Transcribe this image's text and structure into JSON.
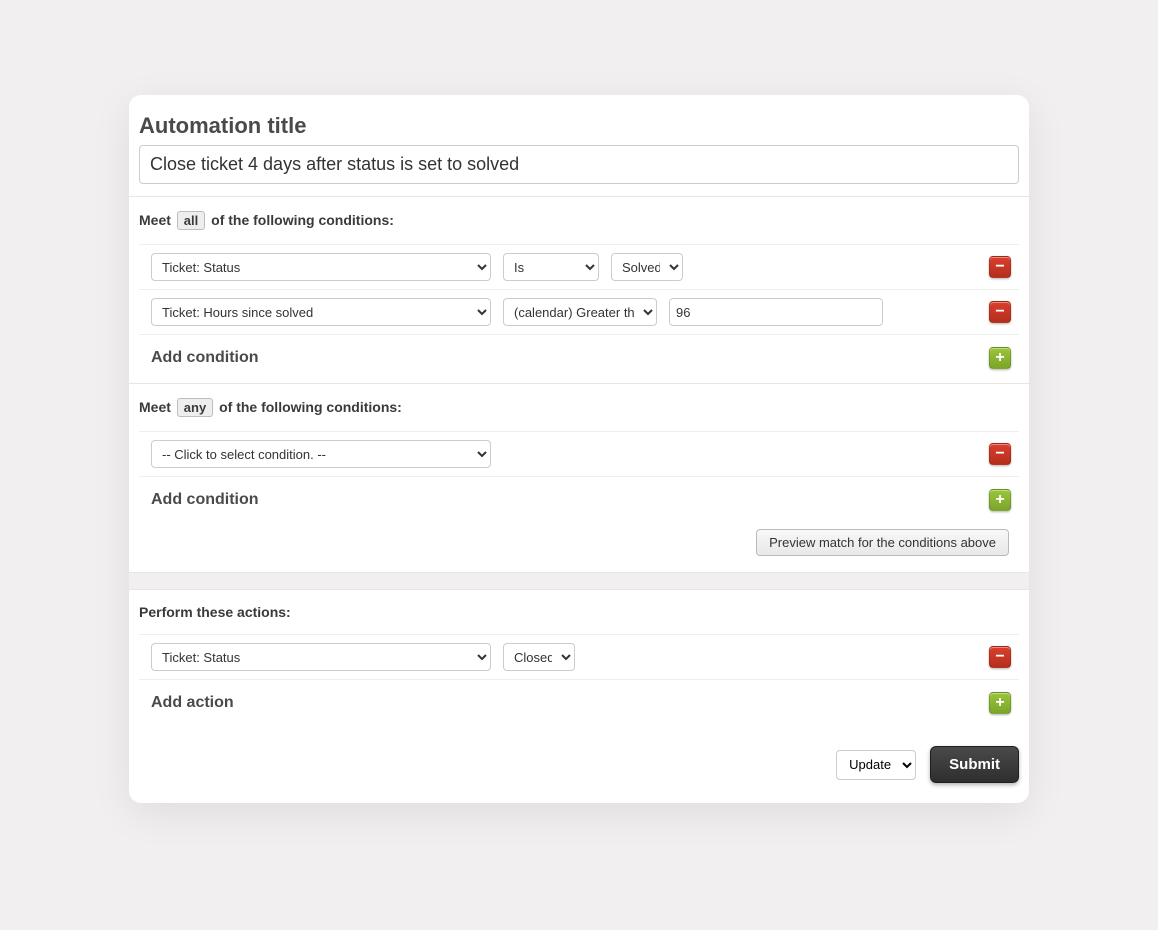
{
  "title_label": "Automation title",
  "title_value": "Close ticket 4 days after status is set to solved",
  "meet_all": {
    "prefix": "Meet",
    "word": "all",
    "suffix": "of the following conditions:"
  },
  "meet_any": {
    "prefix": "Meet",
    "word": "any",
    "suffix": "of the following conditions:"
  },
  "all_conditions": [
    {
      "field": "Ticket: Status",
      "operator": "Is",
      "value": "Solved",
      "value_type": "select"
    },
    {
      "field": "Ticket: Hours since solved",
      "operator": "(calendar) Greater than",
      "value": "96",
      "value_type": "text"
    }
  ],
  "any_conditions": [
    {
      "field": "-- Click to select condition. --"
    }
  ],
  "actions_label": "Perform these actions:",
  "actions": [
    {
      "field": "Ticket: Status",
      "value": "Closed"
    }
  ],
  "add_condition_label": "Add condition",
  "add_action_label": "Add action",
  "preview_label": "Preview match for the conditions above",
  "footer_mode": "Update",
  "submit_label": "Submit"
}
